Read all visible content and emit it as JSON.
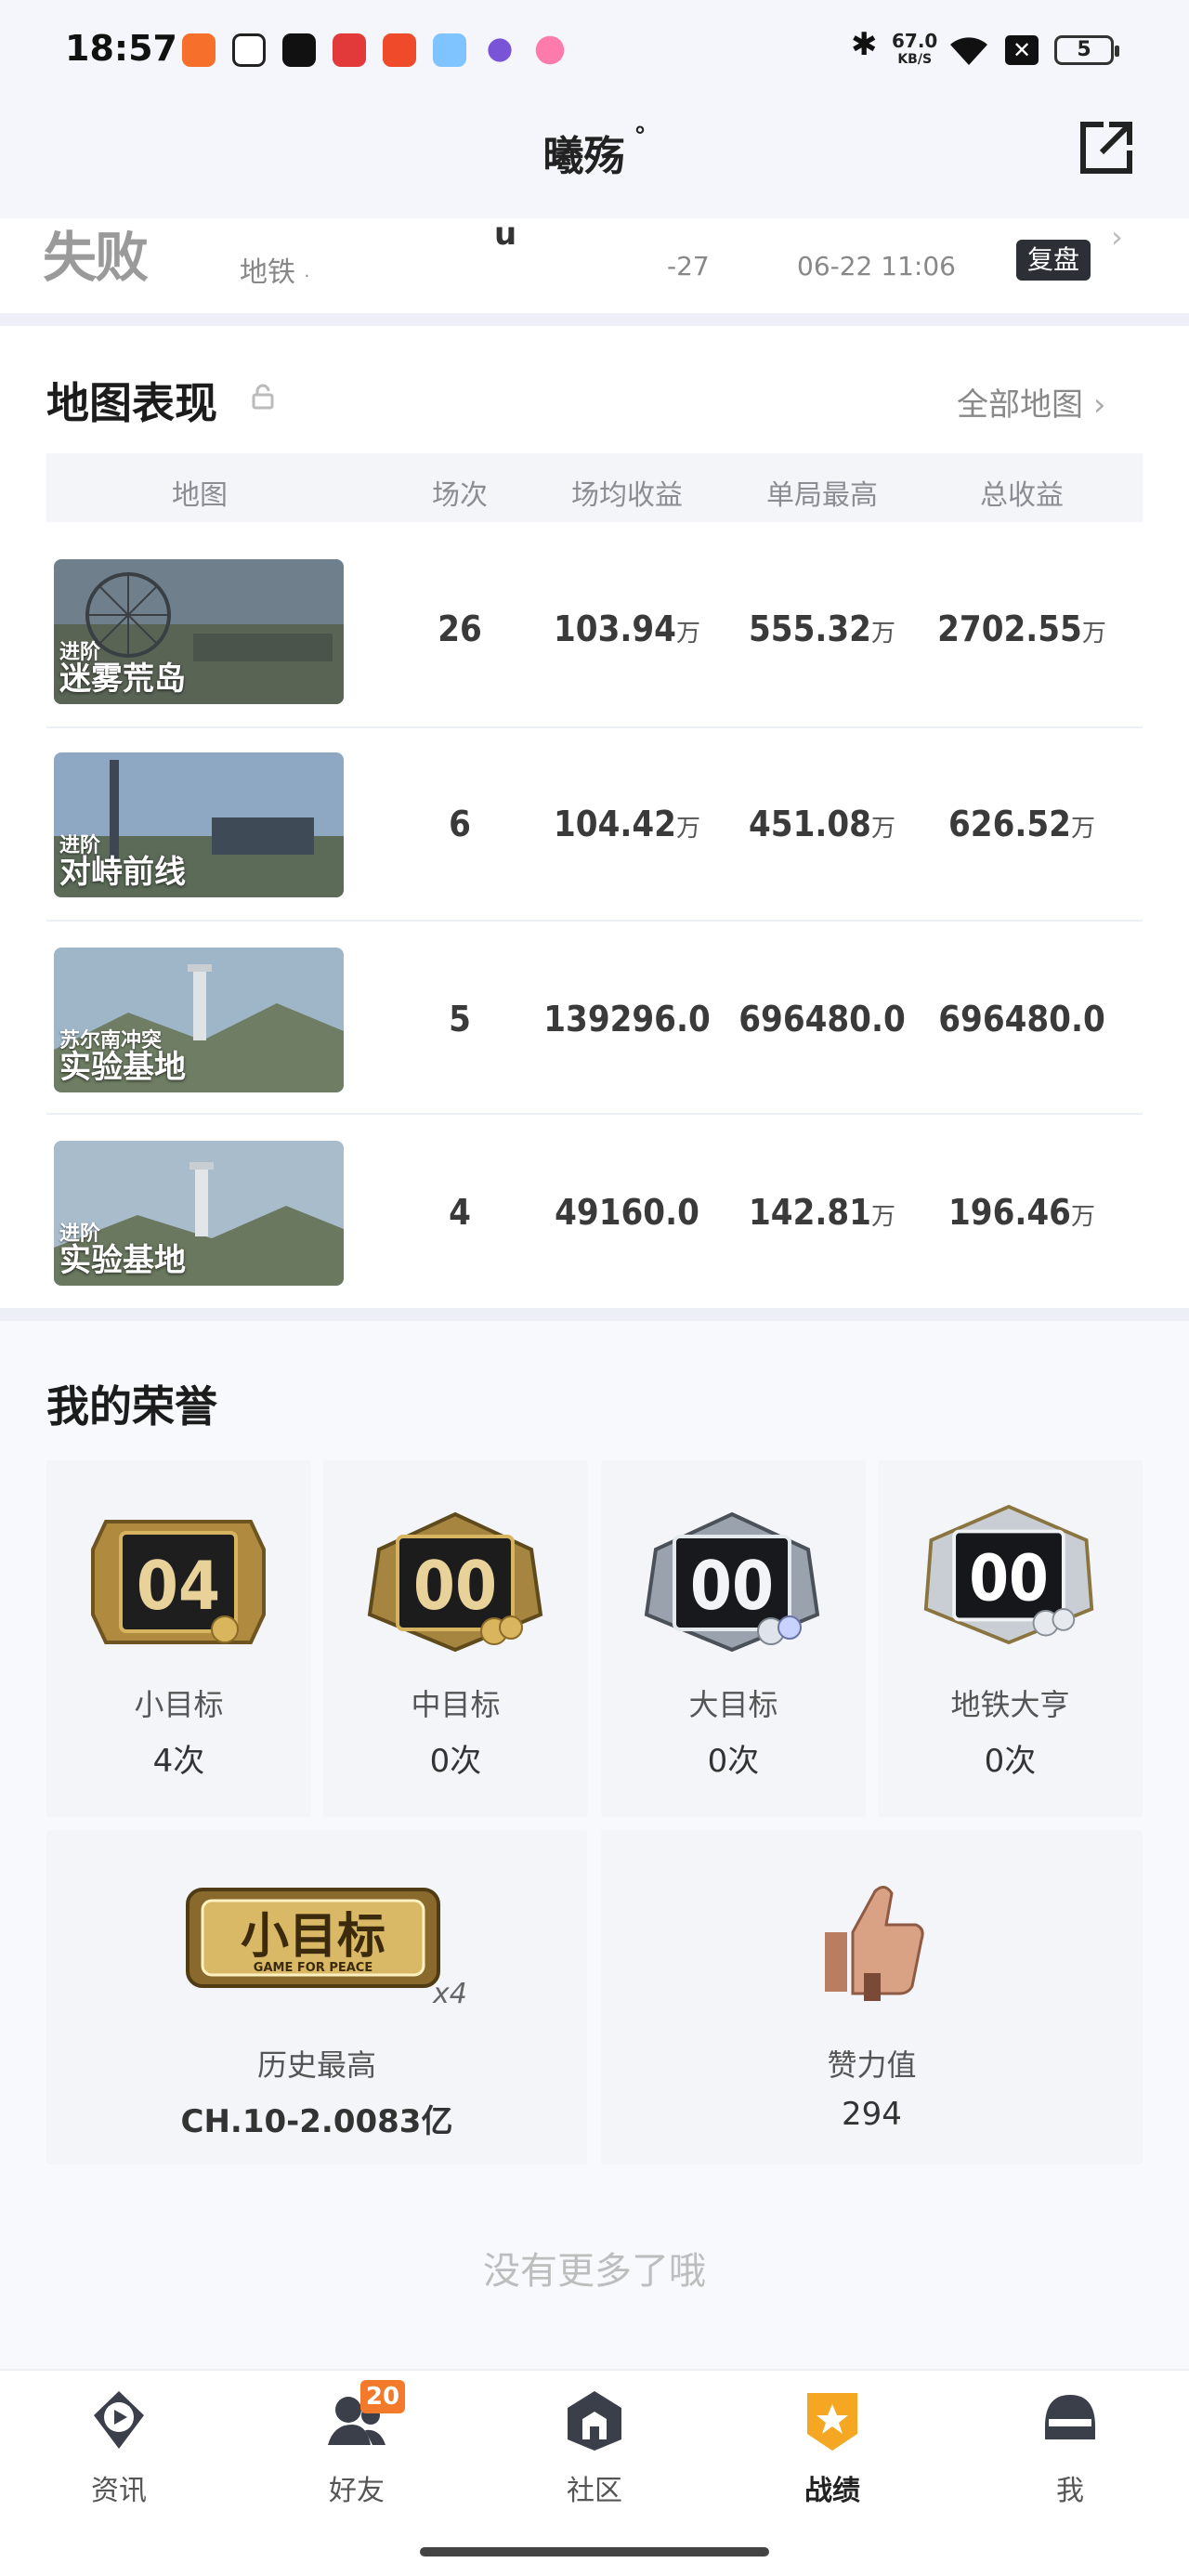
{
  "status_bar": {
    "time": "18:57",
    "net_speed": "67.0",
    "net_unit": "KB/S",
    "battery": "5"
  },
  "header": {
    "title": "曦殇",
    "title_mark": "°"
  },
  "prev_record": {
    "result": "失败",
    "map": "地铁",
    "map_sub": "·",
    "mark": "u",
    "score": "-27",
    "date": "06-22 11:06",
    "replay_label": "复盘"
  },
  "map_section": {
    "title": "地图表现",
    "all_maps_label": "全部地图",
    "columns": [
      "地图",
      "场次",
      "场均收益",
      "单局最高",
      "总收益"
    ],
    "rows": [
      {
        "mode": "进阶",
        "map": "迷雾荒岛",
        "games": "26",
        "avg": "103.94",
        "avg_unit": "万",
        "best": "555.32",
        "best_unit": "万",
        "total": "2702.55",
        "total_unit": "万"
      },
      {
        "mode": "进阶",
        "map": "对峙前线",
        "games": "6",
        "avg": "104.42",
        "avg_unit": "万",
        "best": "451.08",
        "best_unit": "万",
        "total": "626.52",
        "total_unit": "万"
      },
      {
        "mode": "苏尔南冲突",
        "map": "实验基地",
        "games": "5",
        "avg": "139296.0",
        "avg_unit": "",
        "best": "696480.0",
        "best_unit": "",
        "total": "696480.0",
        "total_unit": ""
      },
      {
        "mode": "进阶",
        "map": "实验基地",
        "games": "4",
        "avg": "49160.0",
        "avg_unit": "",
        "best": "142.81",
        "best_unit": "万",
        "total": "196.46",
        "total_unit": "万"
      }
    ]
  },
  "honors": {
    "title": "我的荣誉",
    "goals": [
      {
        "badge": "04",
        "label": "小目标",
        "count": "4次",
        "tier": "gold"
      },
      {
        "badge": "00",
        "label": "中目标",
        "count": "0次",
        "tier": "gold"
      },
      {
        "badge": "00",
        "label": "大目标",
        "count": "0次",
        "tier": "silver"
      },
      {
        "badge": "00",
        "label": "地铁大亨",
        "count": "0次",
        "tier": "diamond"
      }
    ],
    "history": {
      "badge_text": "小目标",
      "badge_sub": "GAME FOR PEACE",
      "badge_mult": "x4",
      "label": "历史最高",
      "value": "CH.10-2.0083亿"
    },
    "likes": {
      "label": "赞力值",
      "value": "294"
    }
  },
  "footer_note": "没有更多了哦",
  "bottom_nav": {
    "items": [
      {
        "label": "资讯",
        "icon": "news-icon"
      },
      {
        "label": "好友",
        "icon": "friends-icon",
        "badge": "20"
      },
      {
        "label": "社区",
        "icon": "community-icon"
      },
      {
        "label": "战绩",
        "icon": "record-icon",
        "active": true
      },
      {
        "label": "我",
        "icon": "profile-icon"
      }
    ]
  },
  "colors": {
    "accent_orange": "#f5a623",
    "badge_orange": "#f37a2a",
    "bg_light": "#f3f5f9",
    "text_dark": "#222222"
  }
}
